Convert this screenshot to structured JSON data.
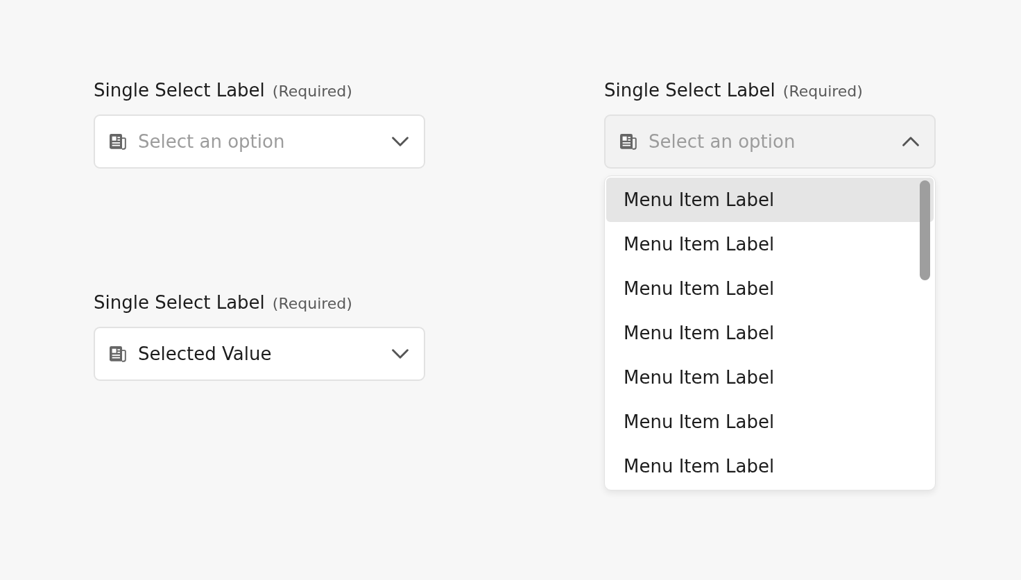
{
  "columns": [
    {
      "fields": [
        {
          "label": "Single Select Label",
          "note": "(Required)",
          "placeholder": "Select an option",
          "expanded": false
        },
        {
          "label": "Single Select Label",
          "note": "(Required)",
          "value": "Selected Value",
          "expanded": false
        }
      ]
    },
    {
      "fields": [
        {
          "label": "Single Select Label",
          "note": "(Required)",
          "placeholder": "Select an option",
          "expanded": true,
          "menu": [
            {
              "label": "Menu Item Label",
              "selected": true
            },
            {
              "label": "Menu Item Label",
              "selected": false
            },
            {
              "label": "Menu Item Label",
              "selected": false
            },
            {
              "label": "Menu Item Label",
              "selected": false
            },
            {
              "label": "Menu Item Label",
              "selected": false
            },
            {
              "label": "Menu Item Label",
              "selected": false
            },
            {
              "label": "Menu Item Label",
              "selected": false
            }
          ]
        }
      ]
    }
  ]
}
